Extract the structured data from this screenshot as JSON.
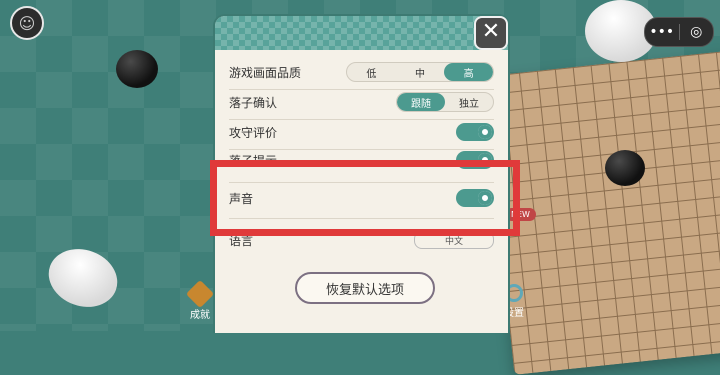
{
  "top_right_capsule": {
    "more_icon": "•••",
    "record_icon": "◎"
  },
  "bottom_nav": {
    "achievements_label": "成就",
    "settings_label": "设置"
  },
  "new_badge": "NEW",
  "settings": {
    "quality": {
      "label": "游戏画面品质",
      "options": [
        "低",
        "中",
        "高"
      ],
      "selected": "高"
    },
    "confirm": {
      "label": "落子确认",
      "options": [
        "跟随",
        "独立"
      ],
      "selected": "跟随"
    },
    "evaluation": {
      "label": "攻守评价",
      "enabled": true
    },
    "hint": {
      "label": "落子提示",
      "enabled": true
    },
    "sound": {
      "label": "声音",
      "enabled": true
    },
    "language": {
      "label": "语言",
      "value": "中文"
    },
    "restore_button": "恢复默认选项"
  },
  "colors": {
    "accent": "#4c9a8f",
    "highlight": "#e03a3a",
    "panel_bg": "#f5f1e8"
  }
}
